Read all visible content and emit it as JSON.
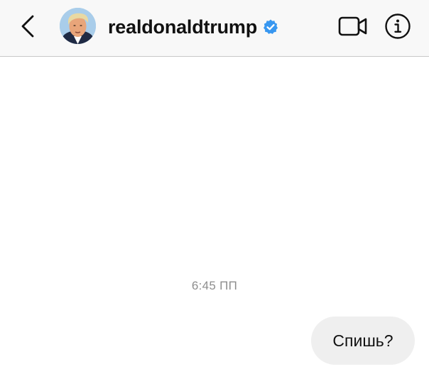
{
  "header": {
    "username": "realdonaldtrump",
    "verified": true,
    "back_icon": "chevron-left-icon",
    "video_icon": "video-camera-icon",
    "info_icon": "info-icon",
    "accent_color": "#3897f0"
  },
  "conversation": {
    "timestamp": "6:45 ПП",
    "messages": [
      {
        "sender": "me",
        "text": "Спишь?"
      }
    ]
  }
}
